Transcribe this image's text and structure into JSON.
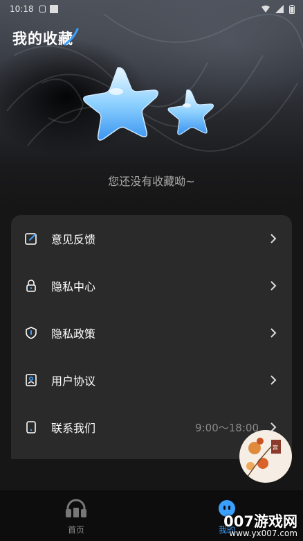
{
  "status": {
    "time": "10:18"
  },
  "page_title": "我的收藏",
  "empty_text": "您还没有收藏呦~",
  "menu": [
    {
      "label": "意见反馈",
      "icon": "feedback-icon"
    },
    {
      "label": "隐私中心",
      "icon": "lock-icon"
    },
    {
      "label": "隐私政策",
      "icon": "shield-icon"
    },
    {
      "label": "用户协议",
      "icon": "user-badge-icon"
    },
    {
      "label": "联系我们",
      "icon": "phone-icon",
      "value": "9:00～18:00"
    }
  ],
  "tabs": [
    {
      "label": "首页",
      "icon": "headphones-icon",
      "active": false
    },
    {
      "label": "我的",
      "icon": "face-icon",
      "active": true
    }
  ],
  "watermark": {
    "name": "007游戏网",
    "url": "www.yx007.com"
  },
  "colors": {
    "accent": "#3aa0ff",
    "menu_bg": "#2a2a2a",
    "page_bg": "#161616"
  }
}
